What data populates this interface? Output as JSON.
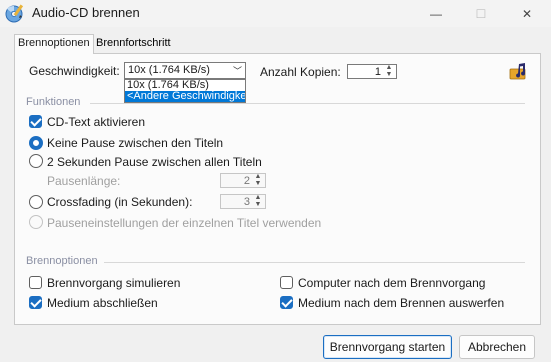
{
  "window": {
    "title": "Audio-CD brennen",
    "minimize_glyph": "—",
    "maximize_glyph": "☐",
    "close_glyph": "✕"
  },
  "tabs": [
    {
      "label": "Brennoptionen",
      "active": true
    },
    {
      "label": "Brennfortschritt",
      "active": false
    }
  ],
  "speed": {
    "label": "Geschwindigkeit:",
    "value": "10x (1.764 KB/s)",
    "options": [
      "10x (1.764 KB/s)",
      "<Andere Geschwindigkeit>"
    ],
    "options_visible": [
      "10x (1.764 KB/s)",
      "<Andere Geschwindigke"
    ]
  },
  "copies": {
    "label": "Anzahl Kopien:",
    "value": "1"
  },
  "functions": {
    "group_label": "Funktionen",
    "cd_text": {
      "label": "CD-Text aktivieren",
      "checked": true
    },
    "no_pause": {
      "label": "Keine Pause zwischen den Titeln",
      "selected": true
    },
    "two_sec_pause": {
      "label": "2 Sekunden Pause zwischen allen Titeln",
      "selected": false
    },
    "pause_length": {
      "label": "Pausenlänge:",
      "value": "2"
    },
    "crossfading": {
      "label": "Crossfading (in Sekunden):",
      "selected": false,
      "value": "3"
    },
    "per_track": {
      "label": "Pauseneinstellungen der einzelnen Titel verwenden",
      "selected": false
    }
  },
  "burn_options": {
    "group_label": "Brennoptionen",
    "simulate": {
      "label": "Brennvorgang simulieren",
      "checked": false
    },
    "finalize": {
      "label": "Medium abschließen",
      "checked": true
    },
    "shutdown": {
      "label": "Computer nach dem Brennvorgang",
      "checked": false
    },
    "eject": {
      "label": "Medium nach dem Brennen auswerfen",
      "checked": true
    }
  },
  "buttons": {
    "start": "Brennvorgang starten",
    "cancel": "Abbrechen"
  },
  "colors": {
    "accent": "#1b6ec2",
    "selection": "#0078d7"
  },
  "icons": {
    "app": "cd-burn-icon",
    "music": "music-note-icon"
  }
}
